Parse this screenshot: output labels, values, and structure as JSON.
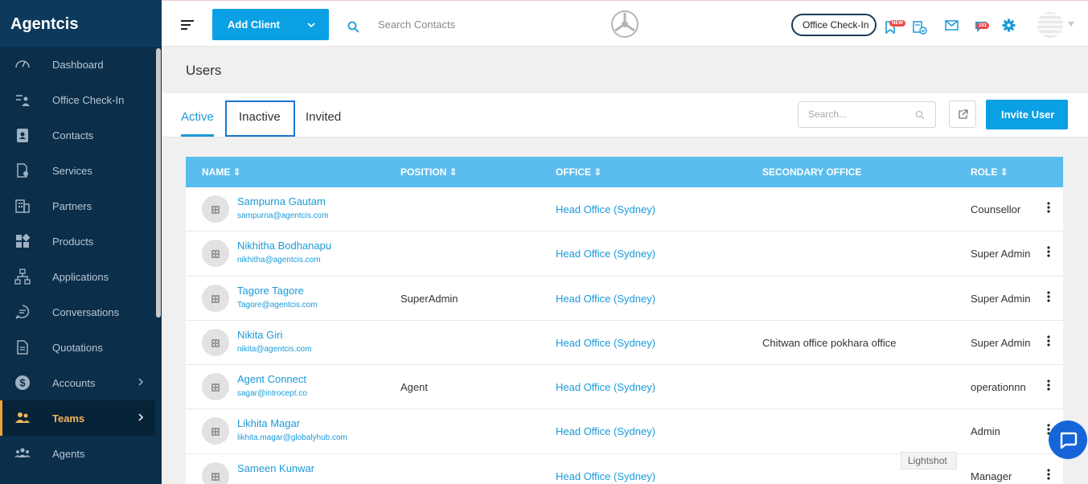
{
  "brand": "Agentcis",
  "sidebar": {
    "items": [
      {
        "label": "Dashboard",
        "icon": "gauge-icon"
      },
      {
        "label": "Office Check-In",
        "icon": "checkin-icon"
      },
      {
        "label": "Contacts",
        "icon": "contact-card-icon"
      },
      {
        "label": "Services",
        "icon": "services-icon"
      },
      {
        "label": "Partners",
        "icon": "building-icon"
      },
      {
        "label": "Products",
        "icon": "grid-icon"
      },
      {
        "label": "Applications",
        "icon": "flow-icon"
      },
      {
        "label": "Conversations",
        "icon": "chat-icon"
      },
      {
        "label": "Quotations",
        "icon": "document-icon"
      },
      {
        "label": "Accounts",
        "icon": "dollar-icon"
      },
      {
        "label": "Teams",
        "icon": "team-icon"
      },
      {
        "label": "Agents",
        "icon": "agents-icon"
      }
    ]
  },
  "topbar": {
    "add_client_label": "Add Client",
    "search_placeholder": "Search Contacts",
    "checkin_label": "Office Check-In",
    "new_badge": "NEW",
    "count_badge": "101"
  },
  "page": {
    "title": "Users"
  },
  "tabs": {
    "active": "Active",
    "inactive": "Inactive",
    "invited": "Invited",
    "search_placeholder": "Search...",
    "invite_label": "Invite User"
  },
  "table": {
    "headers": {
      "name": "NAME ⇕",
      "position": "POSITION ⇕",
      "office": "OFFICE ⇕",
      "secondary_office": "SECONDARY OFFICE",
      "role": "ROLE ⇕"
    },
    "rows": [
      {
        "name": "Sampurna Gautam",
        "email": "sampurna@agentcis.com",
        "position": "",
        "office": "Head Office (Sydney)",
        "secondary": "",
        "role": "Counsellor"
      },
      {
        "name": "Nikhitha Bodhanapu",
        "email": "nikhitha@agentcis.com",
        "position": "",
        "office": "Head Office (Sydney)",
        "secondary": "",
        "role": "Super Admin"
      },
      {
        "name": "Tagore Tagore",
        "email": "Tagore@agentcis.com",
        "position": "SuperAdmin",
        "office": "Head Office (Sydney)",
        "secondary": "",
        "role": "Super Admin"
      },
      {
        "name": "Nikita Giri",
        "email": "nikita@agentcis.com",
        "position": "",
        "office": "Head Office (Sydney)",
        "secondary": "Chitwan office pokhara office",
        "role": "Super Admin"
      },
      {
        "name": "Agent Connect",
        "email": "sagar@introcept.co",
        "position": "Agent",
        "office": "Head Office (Sydney)",
        "secondary": "",
        "role": "operationnn"
      },
      {
        "name": "Likhita Magar",
        "email": "likhita.magar@globalyhub.com",
        "position": "",
        "office": "Head Office (Sydney)",
        "secondary": "",
        "role": "Admin"
      },
      {
        "name": "Sameen Kunwar",
        "email": "",
        "position": "",
        "office": "Head Office (Sydney)",
        "secondary": "",
        "role": "Manager"
      }
    ]
  },
  "tooltip": "Lightshot",
  "colors": {
    "accent": "#0aa0e4",
    "sidebar": "#0b2e4a",
    "active_nav": "#f4b65a",
    "table_header": "#5bbdee"
  }
}
